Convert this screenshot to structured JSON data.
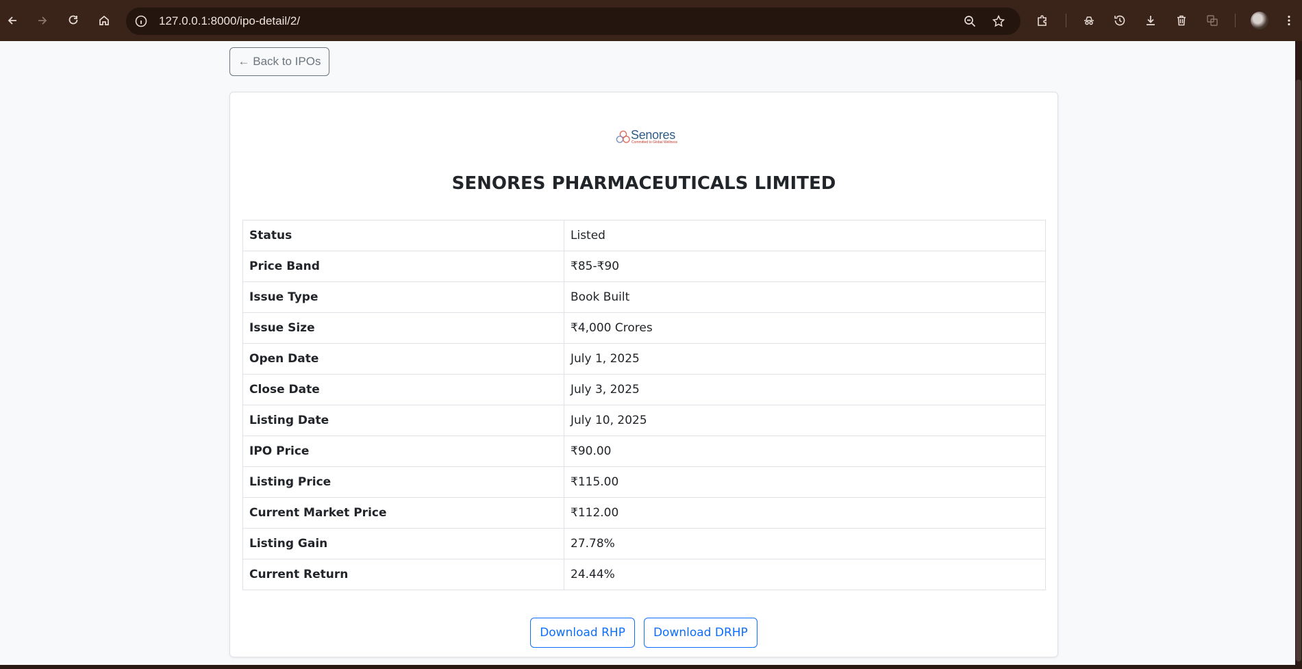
{
  "browser": {
    "url": "127.0.0.1:8000/ipo-detail/2/",
    "icons": [
      "back-icon",
      "forward-icon",
      "reload-icon",
      "home-icon",
      "site-info-icon",
      "zoom-icon",
      "bookmark-star-icon",
      "extensions-icon",
      "incognito-icon",
      "history-icon",
      "download-icon",
      "delete-icon",
      "translate-icon",
      "profile-avatar",
      "menu-icon"
    ]
  },
  "page": {
    "back_label": "← Back to IPOs",
    "logo": {
      "name": "Senores",
      "tagline": "Committed to Global Wellness"
    },
    "company_name": "SENORES PHARMACEUTICALS LIMITED",
    "details": [
      {
        "label": "Status",
        "value": "Listed"
      },
      {
        "label": "Price Band",
        "value": "₹85-₹90"
      },
      {
        "label": "Issue Type",
        "value": "Book Built"
      },
      {
        "label": "Issue Size",
        "value": "₹4,000 Crores"
      },
      {
        "label": "Open Date",
        "value": "July 1, 2025"
      },
      {
        "label": "Close Date",
        "value": "July 3, 2025"
      },
      {
        "label": "Listing Date",
        "value": "July 10, 2025"
      },
      {
        "label": "IPO Price",
        "value": "₹90.00"
      },
      {
        "label": "Listing Price",
        "value": "₹115.00"
      },
      {
        "label": "Current Market Price",
        "value": "₹112.00"
      },
      {
        "label": "Listing Gain",
        "value": "27.78%"
      },
      {
        "label": "Current Return",
        "value": "24.44%"
      }
    ],
    "download_rhp_label": "Download RHP",
    "download_drhp_label": "Download DRHP"
  },
  "colors": {
    "primary": "#0d6efd",
    "secondary": "#6c757d",
    "chrome": "#3a2319"
  }
}
